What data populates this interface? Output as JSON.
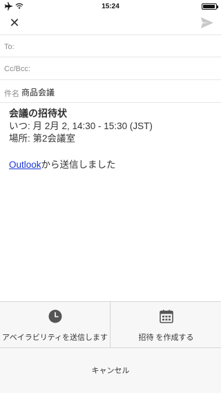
{
  "status_bar": {
    "time": "15:24",
    "battery_level_percent": 95
  },
  "toolbar": {
    "close_icon": "close-icon",
    "send_icon": "send-icon"
  },
  "compose": {
    "to_label": "To:",
    "cc_label": "Cc/Bcc:",
    "subject_label": "件名",
    "subject_value": "商品会議"
  },
  "body": {
    "title": "会議の招待状",
    "when_line": "いつ: 月 2月 2, 14:30 - 15:30 (JST)",
    "where_line": "場所: 第2会議室",
    "signature_link": "Outlook",
    "signature_rest": "から送信しました"
  },
  "action_sheet": {
    "availability_label": "アベイラビリティを送信します",
    "availability_icon": "clock-icon",
    "invite_label": "招待 を作成する",
    "invite_icon": "calendar-icon",
    "cancel_label": "キャンセル"
  }
}
